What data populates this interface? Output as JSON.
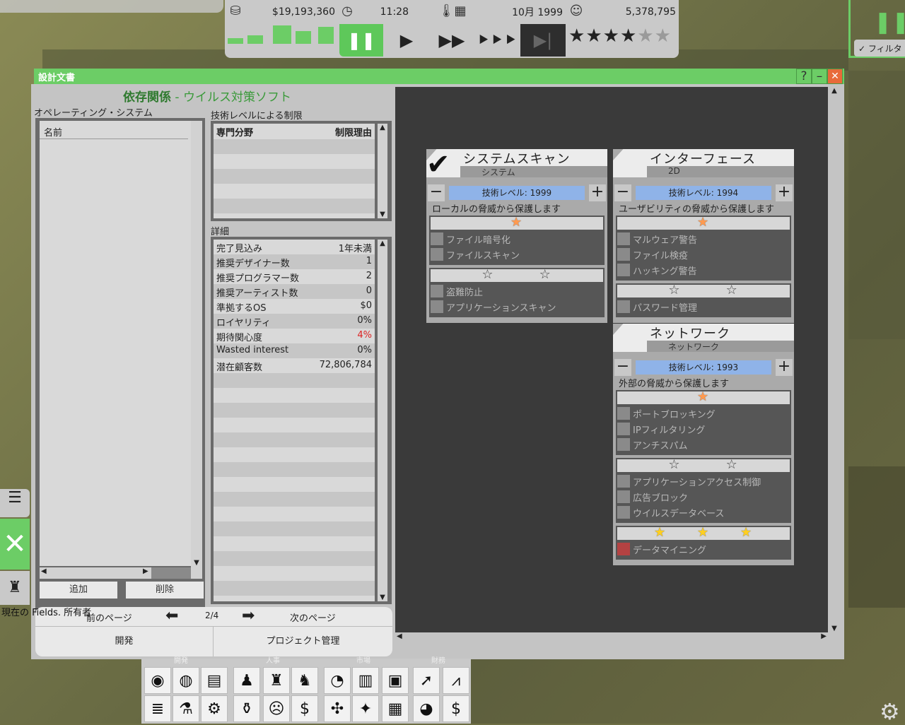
{
  "hud": {
    "money": "$19,193,360",
    "time": "11:28",
    "date": "10月 1999",
    "fans": "5,378,795",
    "rating_filled": 4,
    "rating_total": 6,
    "speed_pause": "❚❚",
    "speed_play": "▶",
    "speed_fast": "▶▶",
    "speed_faster": "⯈⯈⯈",
    "speed_skip": "▶|"
  },
  "filter_label": "フィルタ",
  "window": {
    "title": "設計文書",
    "help": "?",
    "minimize": "–",
    "close": "✕",
    "heading_prefix": "依存関係",
    "heading_sep": " - ",
    "heading_suffix": "ウイルス対策ソフト"
  },
  "os": {
    "label": "オペレーティング・システム",
    "column": "名前",
    "add": "追加",
    "remove": "削除"
  },
  "limits": {
    "label": "技術レベルによる制限",
    "col_field": "専門分野",
    "col_reason": "制限理由"
  },
  "details": {
    "label": "詳細",
    "rows": [
      {
        "k": "完了見込み",
        "v": "1年未満"
      },
      {
        "k": "推奨デザイナー数",
        "v": "1"
      },
      {
        "k": "推奨プログラマー数",
        "v": "2"
      },
      {
        "k": "推奨アーティスト数",
        "v": "0"
      },
      {
        "k": "準拠するOS",
        "v": "$0"
      },
      {
        "k": "ロイヤリティ",
        "v": "0%"
      },
      {
        "k": "期待関心度",
        "v": "4%"
      },
      {
        "k": "Wasted interest",
        "v": "0%"
      },
      {
        "k": "潜在顧客数",
        "v": "72,806,784"
      }
    ]
  },
  "nav": {
    "prev": "前のページ",
    "page": "2/4",
    "next": "次のページ",
    "develop": "開発",
    "project": "プロジェクト管理"
  },
  "cards": [
    {
      "title": "システムスキャン",
      "category": "システム",
      "level": "技術レベル: 1999",
      "desc": "ローカルの脅威から保護します",
      "checked": true,
      "groups": [
        {
          "stars": [
            "orange"
          ],
          "items": [
            "ファイル暗号化",
            "ファイルスキャン"
          ]
        },
        {
          "stars": [
            "empty",
            "empty"
          ],
          "items": [
            "盗難防止",
            "アプリケーションスキャン"
          ]
        }
      ]
    },
    {
      "title": "インターフェース",
      "category": "2D",
      "level": "技術レベル: 1994",
      "desc": "ユーザビリティの脅威から保護します",
      "checked": false,
      "groups": [
        {
          "stars": [
            "orange"
          ],
          "items": [
            "マルウェア警告",
            "ファイル検疫",
            "ハッキング警告"
          ]
        },
        {
          "stars": [
            "empty",
            "empty"
          ],
          "items": [
            "パスワード管理"
          ]
        }
      ]
    },
    {
      "title": "ネットワーク",
      "category": "ネットワーク",
      "level": "技術レベル: 1993",
      "desc": "外部の脅威から保護します",
      "checked": false,
      "groups": [
        {
          "stars": [
            "orange"
          ],
          "items": [
            "ポートブロッキング",
            "IPフィルタリング",
            "アンチスパム"
          ]
        },
        {
          "stars": [
            "empty",
            "empty"
          ],
          "items": [
            "アプリケーションアクセス制御",
            "広告ブロック",
            "ウイルスデータベース"
          ]
        },
        {
          "stars": [
            "gold",
            "gold",
            "gold"
          ],
          "items": [
            "データマイニング"
          ],
          "red": true
        }
      ]
    }
  ],
  "bottom": {
    "categories": [
      "開発",
      "人事",
      "市場",
      "財務"
    ]
  },
  "side_text": "現在の Fields. 所有者"
}
